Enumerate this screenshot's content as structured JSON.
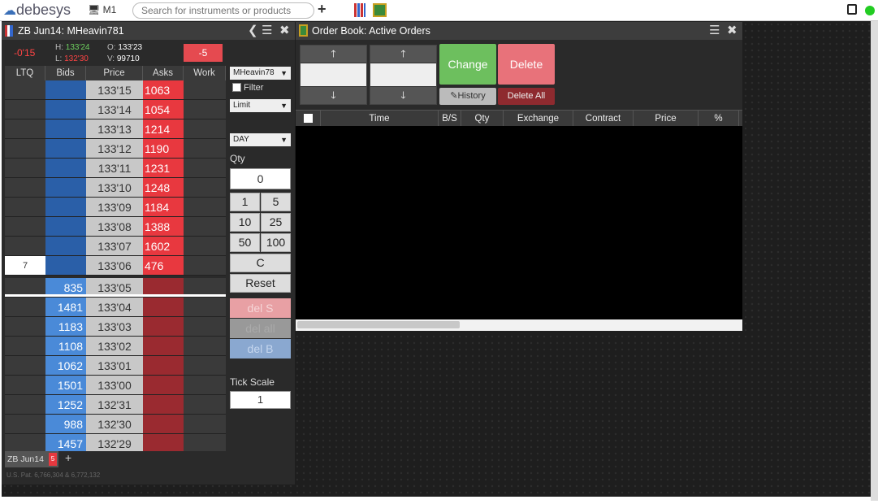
{
  "topbar": {
    "logo": "debesys",
    "monitor_label": "M1",
    "search_placeholder": "Search for instruments or products"
  },
  "ladder": {
    "title": "ZB Jun14: MHeavin781",
    "net_change": "-0'15",
    "high_label": "H:",
    "high": "133'24",
    "low_label": "L:",
    "low": "132'30",
    "open_label": "O:",
    "open": "133'23",
    "volume_label": "V:",
    "volume": "99710",
    "position": "-5",
    "columns": [
      "LTQ",
      "Bids",
      "Price",
      "Asks",
      "Work"
    ],
    "rows": [
      {
        "ltq": "",
        "bid": "",
        "price": "133'15",
        "ask": "1063"
      },
      {
        "ltq": "",
        "bid": "",
        "price": "133'14",
        "ask": "1054"
      },
      {
        "ltq": "",
        "bid": "",
        "price": "133'13",
        "ask": "1214"
      },
      {
        "ltq": "",
        "bid": "",
        "price": "133'12",
        "ask": "1190"
      },
      {
        "ltq": "",
        "bid": "",
        "price": "133'11",
        "ask": "1231"
      },
      {
        "ltq": "",
        "bid": "",
        "price": "133'10",
        "ask": "1248"
      },
      {
        "ltq": "",
        "bid": "",
        "price": "133'09",
        "ask": "1184"
      },
      {
        "ltq": "",
        "bid": "",
        "price": "133'08",
        "ask": "1388"
      },
      {
        "ltq": "",
        "bid": "",
        "price": "133'07",
        "ask": "1602"
      },
      {
        "ltq": "7",
        "bid": "",
        "price": "133'06",
        "ask": "476"
      },
      {
        "ltq": "",
        "bid": "835",
        "price": "133'05",
        "ask": ""
      },
      {
        "ltq": "",
        "bid": "1481",
        "price": "133'04",
        "ask": ""
      },
      {
        "ltq": "",
        "bid": "1183",
        "price": "133'03",
        "ask": ""
      },
      {
        "ltq": "",
        "bid": "1108",
        "price": "133'02",
        "ask": ""
      },
      {
        "ltq": "",
        "bid": "1062",
        "price": "133'01",
        "ask": ""
      },
      {
        "ltq": "",
        "bid": "1501",
        "price": "133'00",
        "ask": ""
      },
      {
        "ltq": "",
        "bid": "1252",
        "price": "132'31",
        "ask": ""
      },
      {
        "ltq": "",
        "bid": "988",
        "price": "132'30",
        "ask": ""
      },
      {
        "ltq": "",
        "bid": "1457",
        "price": "132'29",
        "ask": ""
      }
    ],
    "tab_label": "ZB Jun14",
    "tab_badge": "5",
    "footer": "U.S. Pat. 6,766,304 & 6,772,132"
  },
  "order_entry": {
    "account": "MHeavin78",
    "filter_label": "Filter",
    "order_type": "Limit",
    "tif": "DAY",
    "qty_label": "Qty",
    "qty_value": "0",
    "qty_buttons": [
      "1",
      "5",
      "10",
      "25",
      "50",
      "100"
    ],
    "clear_label": "C",
    "reset_label": "Reset",
    "del_s": "del S",
    "del_all": "del all",
    "del_b": "del B",
    "tick_scale_label": "Tick Scale",
    "tick_scale_value": "1"
  },
  "order_book": {
    "title": "Order Book: Active Orders",
    "change_label": "Change",
    "delete_label": "Delete",
    "history_label": "History",
    "delete_all_label": "Delete All",
    "columns": [
      "Time",
      "B/S",
      "Qty",
      "Exchange",
      "Contract",
      "Price",
      "%"
    ]
  },
  "colors": {
    "bid_dark": "#2a5fa8",
    "bid_light": "#4a8ad8",
    "ask_bright": "#e8383f",
    "ask_dark": "#9a2a30",
    "change_green": "#6dbf5e",
    "delete_red": "#e8727a"
  }
}
